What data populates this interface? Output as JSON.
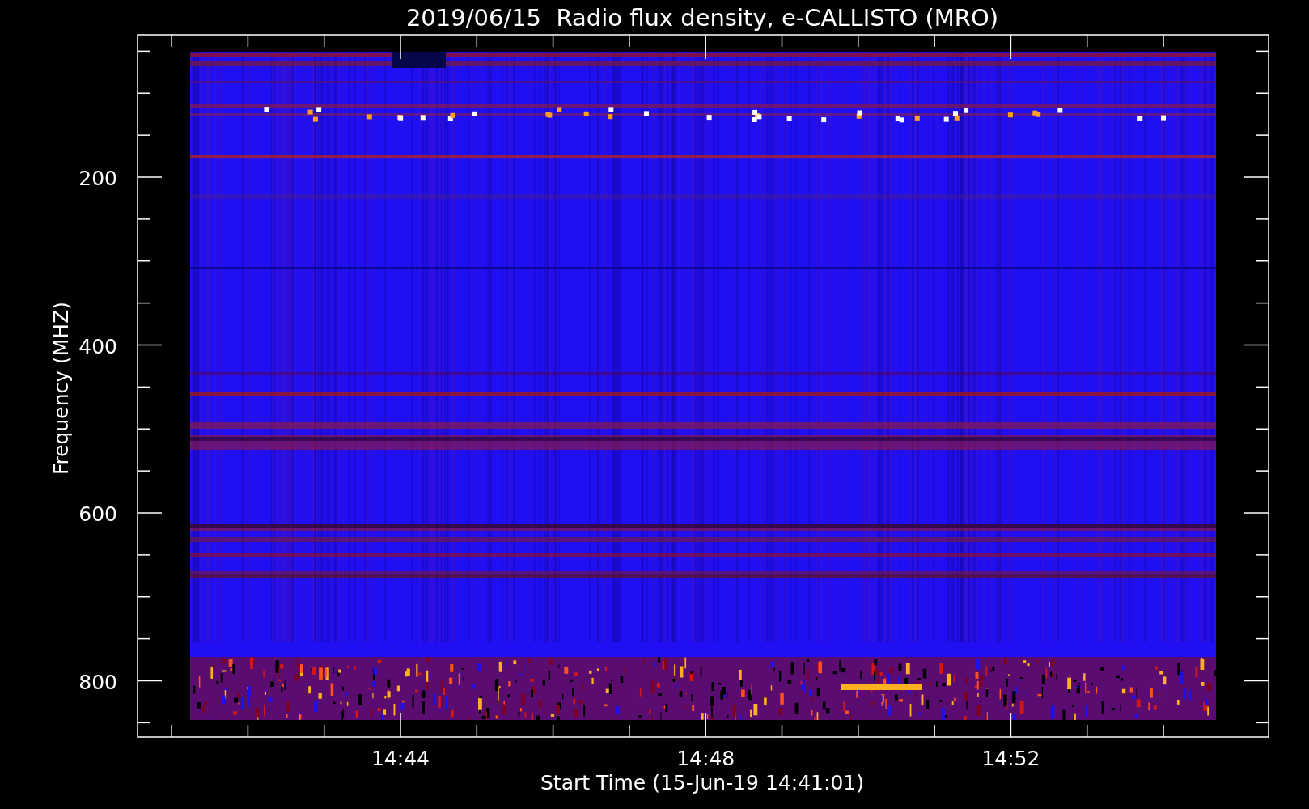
{
  "title": "2019/06/15  Radio flux density, e-CALLISTO (MRO)",
  "y_axis": {
    "label": "Frequency (MHZ)",
    "ticks": [
      "200",
      "400",
      "600",
      "800"
    ]
  },
  "x_axis": {
    "label": "Start Time (15-Jun-19 14:41:01)",
    "ticks": [
      "14:44",
      "14:48",
      "14:52"
    ]
  }
}
